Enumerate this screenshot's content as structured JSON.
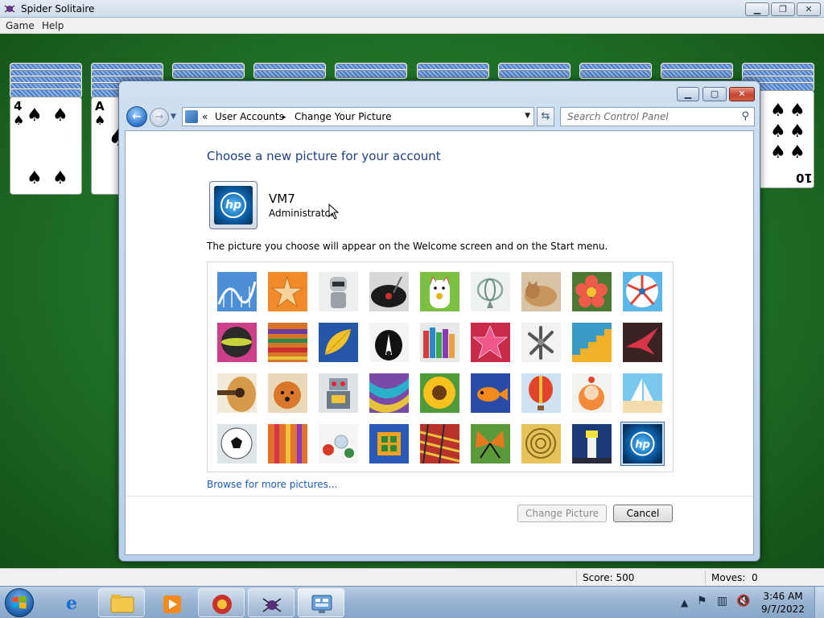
{
  "solitaire": {
    "title": "Spider Solitaire",
    "menu": [
      "Game",
      "Help"
    ],
    "window_buttons": [
      "minimize",
      "restore",
      "close"
    ],
    "tableau_ranks": [
      "4",
      "A",
      "10"
    ],
    "status": {
      "score_label": "Score: 500",
      "moves_label": "Moves:",
      "moves_value": "0"
    }
  },
  "dialog": {
    "window_buttons": [
      "minimize",
      "maximize",
      "close"
    ],
    "breadcrumb": {
      "chevrons": "«",
      "items": [
        "User Accounts",
        "Change Your Picture"
      ],
      "separator": "▸"
    },
    "search_placeholder": "Search Control Panel",
    "heading": "Choose a new picture for your account",
    "user": {
      "name": "VM7",
      "role": "Administrator",
      "picture_logo": "hp"
    },
    "hint": "The picture you choose will appear on the Welcome screen and on the Start menu.",
    "pictures": [
      [
        "roller-coaster",
        "starfish",
        "robot",
        "record-player",
        "lucky-cat",
        "gyroscope",
        "kitten",
        "flower",
        "pinwheel"
      ],
      [
        "ball",
        "fabric",
        "leaf",
        "dog",
        "crayons",
        "paper-star",
        "jacks",
        "stairs",
        "origami-crane"
      ],
      [
        "guitar",
        "puppy",
        "toy-robot",
        "scarf",
        "sunflower",
        "fish",
        "hot-air-balloon",
        "doll",
        "sailboat"
      ],
      [
        "soccer-ball",
        "weave",
        "marbles",
        "window",
        "textile",
        "butterfly",
        "spiral",
        "lighthouse",
        "hp-logo"
      ]
    ],
    "selected_picture": "hp-logo",
    "browse_link": "Browse for more pictures...",
    "change_button": "Change Picture",
    "cancel_button": "Cancel"
  },
  "taskbar": {
    "buttons": [
      "start",
      "internet-explorer",
      "windows-explorer",
      "media-player",
      "solitaire-red",
      "spider-solitaire",
      "control-panel"
    ],
    "clock_time": "3:46 AM",
    "clock_date": "9/7/2022",
    "tray_icons": [
      "show-hidden-icon",
      "action-center-flag-icon",
      "network-icon",
      "volume-muted-icon"
    ]
  },
  "colors": {
    "felt": "#1f6f26",
    "heading": "#1e3f80",
    "link": "#1b5ab8"
  }
}
